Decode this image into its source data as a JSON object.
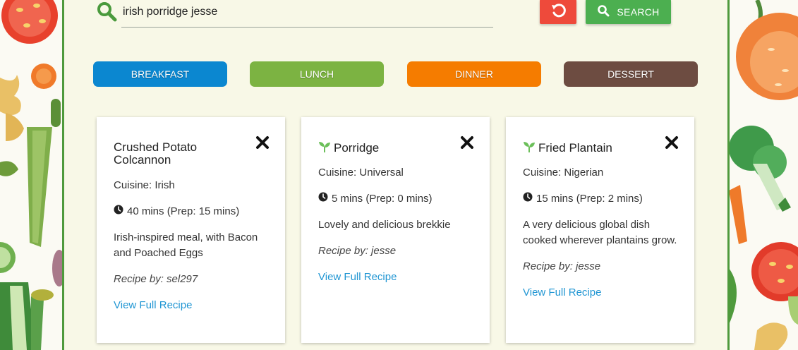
{
  "search": {
    "value": "irish porridge jesse",
    "button_label": "SEARCH"
  },
  "categories": [
    {
      "label": "BREAKFAST",
      "color": "#0b87d0"
    },
    {
      "label": "LUNCH",
      "color": "#7cb342"
    },
    {
      "label": "DINNER",
      "color": "#f57c00"
    },
    {
      "label": "DESSERT",
      "color": "#6d4c41"
    }
  ],
  "recipes": [
    {
      "title": "Crushed Potato Colcannon",
      "vegetarian": false,
      "cuisine": "Cuisine: Irish",
      "time": "40 mins (Prep: 15 mins)",
      "description": "Irish-inspired meal, with Bacon and Poached Eggs",
      "author": "Recipe by: sel297",
      "link": "View Full Recipe"
    },
    {
      "title": "Porridge",
      "vegetarian": true,
      "cuisine": "Cuisine: Universal",
      "time": "5 mins (Prep: 0 mins)",
      "description": "Lovely and delicious brekkie",
      "author": "Recipe by: jesse",
      "link": "View Full Recipe"
    },
    {
      "title": "Fried Plantain",
      "vegetarian": true,
      "cuisine": "Cuisine: Nigerian",
      "time": "15 mins (Prep: 2 mins)",
      "description": "A very delicious global dish cooked wherever plantains grow.",
      "author": "Recipe by: jesse",
      "link": "View Full Recipe"
    }
  ],
  "icons": {
    "search": "search-icon",
    "reset": "undo-icon",
    "close": "close-icon",
    "vegetarian": "sprout-icon",
    "time": "clock-icon"
  },
  "colors": {
    "accent_green": "#4caf50",
    "reset_red": "#ee4a3b",
    "link_blue": "#2196d3",
    "panel_bg": "#f8f8e7",
    "panel_border": "#4f9a3c"
  }
}
